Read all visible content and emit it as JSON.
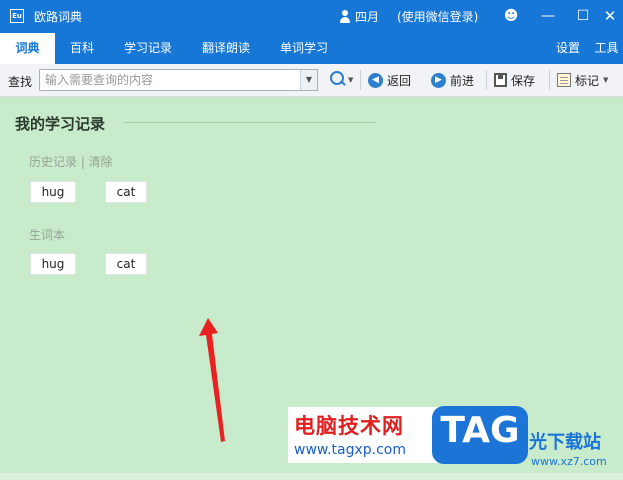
{
  "window": {
    "title": "欧路词典",
    "logo_text": "Eu",
    "user_name": "四月",
    "login_hint": "(使用微信登录)",
    "controls": {
      "smile": "☻",
      "minimize": "—",
      "maximize": "☐",
      "close": "✕"
    }
  },
  "tabs": {
    "left": [
      "词典",
      "百科",
      "学习记录",
      "翻译朗读",
      "单词学习"
    ],
    "right": [
      "设置",
      "工具"
    ],
    "active": "词典"
  },
  "toolbar": {
    "search_label": "查找",
    "search_placeholder": "输入需要查询的内容",
    "back_label": "返回",
    "forward_label": "前进",
    "save_label": "保存",
    "mark_label": "标记"
  },
  "content": {
    "title": "我的学习记录",
    "history_label": "历史记录 | 清除",
    "history_words": [
      "hug",
      "cat"
    ],
    "vocab_label": "生词本",
    "vocab_words": [
      "hug",
      "cat"
    ]
  },
  "watermark": {
    "left_title": "电脑技术网",
    "left_url": "www.tagxp.com",
    "logo": "TAG",
    "right_title": "光下载站",
    "right_url": "www.xz7.com"
  },
  "colors": {
    "titlebar": "#1677d6",
    "content_background": "#c8ebcb",
    "annotation_arrow": "#e82222"
  }
}
